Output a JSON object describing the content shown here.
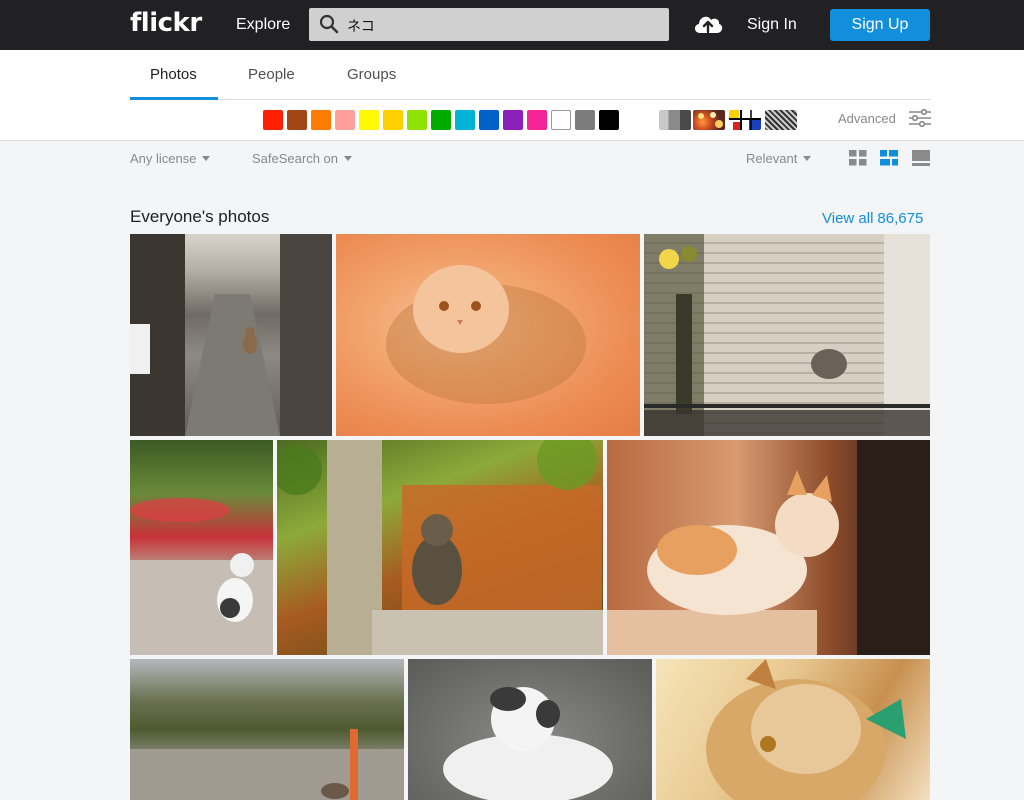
{
  "header": {
    "logo": "flickr",
    "explore": "Explore",
    "search_value": "ネコ",
    "sign_in": "Sign In",
    "sign_up": "Sign Up"
  },
  "tabs": [
    {
      "label": "Photos",
      "active": true
    },
    {
      "label": "People",
      "active": false
    },
    {
      "label": "Groups",
      "active": false
    }
  ],
  "colors": [
    "#ff2000",
    "#a24615",
    "#ff7c00",
    "#ff9f9c",
    "#fffa00",
    "#ffcf00",
    "#90e200",
    "#00ab00",
    "#00b2d4",
    "#0062c6",
    "#8c20ba",
    "#f52394",
    "#ffffff",
    "#7c7c7c",
    "#000000"
  ],
  "styles": [
    "black-and-white",
    "shallow-depth-of-field",
    "minimalist",
    "patterns"
  ],
  "advanced_label": "Advanced",
  "filters": {
    "license": "Any license",
    "safesearch": "SafeSearch on",
    "sort": "Relevant"
  },
  "section": {
    "title": "Everyone's photos",
    "view_all_label": "View all",
    "count": "86,675"
  },
  "accent_color": "#128fdc"
}
